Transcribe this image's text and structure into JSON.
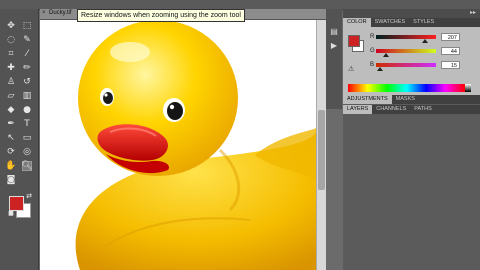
{
  "document": {
    "tab_label": "Ducky.tif"
  },
  "tooltip": {
    "text": "Resize windows when zooming using the zoom tool"
  },
  "color_panel": {
    "tabs": [
      "COLOR",
      "SWATCHES",
      "STYLES"
    ],
    "active_tab": "COLOR",
    "fg_color": "#cc2222",
    "bg_color": "#ffffff",
    "channels": [
      {
        "label": "R",
        "value": "207",
        "fraction": 0.81,
        "gradient": "linear-gradient(to right,#002020,#ff2020)"
      },
      {
        "label": "G",
        "value": "44",
        "fraction": 0.17,
        "gradient": "linear-gradient(to right,#cf0020,#cfff20)"
      },
      {
        "label": "B",
        "value": "15",
        "fraction": 0.06,
        "gradient": "linear-gradient(to right,#cf2c00,#cf2cff)"
      }
    ]
  },
  "adjustments_panel": {
    "tabs": [
      "ADJUSTMENTS",
      "MASKS"
    ],
    "active_tab": "ADJUSTMENTS"
  },
  "layers_panel": {
    "tabs": [
      "LAYERS",
      "CHANNELS",
      "PATHS"
    ],
    "active_tab": "LAYERS"
  },
  "toolbox": {
    "fg_color": "#cc2222",
    "bg_color": "#ffffff",
    "tools": [
      {
        "name": "move-tool",
        "glyph": "✥"
      },
      {
        "name": "marquee-tool",
        "glyph": "⬚"
      },
      {
        "name": "lasso-tool",
        "glyph": "◌"
      },
      {
        "name": "quick-select-tool",
        "glyph": "✎"
      },
      {
        "name": "crop-tool",
        "glyph": "⌗"
      },
      {
        "name": "eyedropper-tool",
        "glyph": "⁄"
      },
      {
        "name": "healing-brush-tool",
        "glyph": "✚"
      },
      {
        "name": "brush-tool",
        "glyph": "✏"
      },
      {
        "name": "clone-stamp-tool",
        "glyph": "♙"
      },
      {
        "name": "history-brush-tool",
        "glyph": "↺"
      },
      {
        "name": "eraser-tool",
        "glyph": "▱"
      },
      {
        "name": "gradient-tool",
        "glyph": "▥"
      },
      {
        "name": "blur-tool",
        "glyph": "◆"
      },
      {
        "name": "dodge-tool",
        "glyph": "●"
      },
      {
        "name": "pen-tool",
        "glyph": "✒"
      },
      {
        "name": "type-tool",
        "glyph": "T"
      },
      {
        "name": "path-select-tool",
        "glyph": "↖"
      },
      {
        "name": "shape-tool",
        "glyph": "▭"
      },
      {
        "name": "3d-rotate-tool",
        "glyph": "⟳"
      },
      {
        "name": "3d-orbit-tool",
        "glyph": "◎"
      },
      {
        "name": "hand-tool",
        "glyph": "✋"
      },
      {
        "name": "zoom-tool",
        "glyph": "🔍︎"
      },
      {
        "name": "quick-mask-tool",
        "glyph": "◙"
      }
    ]
  }
}
